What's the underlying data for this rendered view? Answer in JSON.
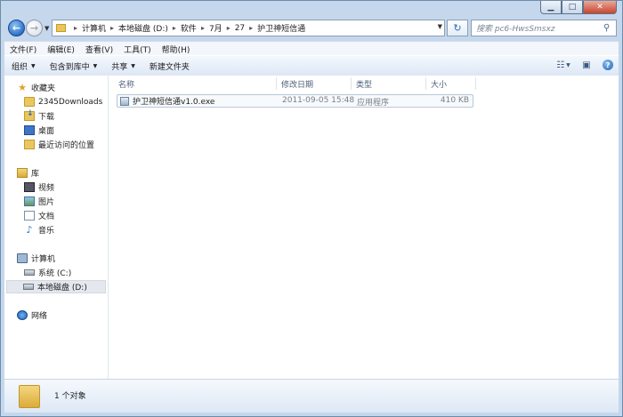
{
  "titlebar": {
    "minimize_glyph": "▁",
    "maximize_glyph": "□",
    "close_glyph": "✕"
  },
  "nav": {
    "back_glyph": "←",
    "forward_glyph": "→",
    "breadcrumbs": [
      "计算机",
      "本地磁盘 (D:)",
      "软件",
      "7月",
      "27",
      "护卫神短信通"
    ],
    "refresh_glyph": "↻",
    "search_placeholder": "搜索 pc6-HwsSmsxz"
  },
  "menu": [
    "文件(F)",
    "编辑(E)",
    "查看(V)",
    "工具(T)",
    "帮助(H)"
  ],
  "toolbar": {
    "organize": "组织",
    "include_in_library": "包含到库中",
    "share": "共享",
    "new_folder": "新建文件夹"
  },
  "sidebar": {
    "favorites": {
      "label": "收藏夹",
      "items": [
        "2345Downloads",
        "下载",
        "桌面",
        "最近访问的位置"
      ]
    },
    "libraries": {
      "label": "库",
      "items": [
        "视频",
        "图片",
        "文档",
        "音乐"
      ]
    },
    "computer": {
      "label": "计算机",
      "items": [
        "系统 (C:)",
        "本地磁盘 (D:)"
      ],
      "selected": "本地磁盘 (D:)"
    },
    "network": {
      "label": "网络"
    }
  },
  "columns": {
    "name": "名称",
    "date": "修改日期",
    "type": "类型",
    "size": "大小"
  },
  "files": [
    {
      "name": "护卫神短信通v1.0.exe",
      "date": "2011-09-05 15:48",
      "type": "应用程序",
      "size": "410 KB"
    }
  ],
  "status": {
    "item_count": "1 个对象"
  },
  "colors": {
    "frame": "#c4d7ec",
    "selection_border": "#b9c7d8",
    "accent": "#2f72c8"
  },
  "icons": [
    "back-arrow-icon",
    "forward-arrow-icon",
    "folder-icon",
    "refresh-icon",
    "search-icon",
    "view-options-icon",
    "preview-pane-icon",
    "help-icon",
    "star-icon",
    "download-folder-icon",
    "desktop-icon",
    "recent-places-icon",
    "library-icon",
    "video-icon",
    "picture-icon",
    "document-icon",
    "music-icon",
    "computer-icon",
    "drive-icon",
    "network-icon",
    "exe-file-icon"
  ]
}
